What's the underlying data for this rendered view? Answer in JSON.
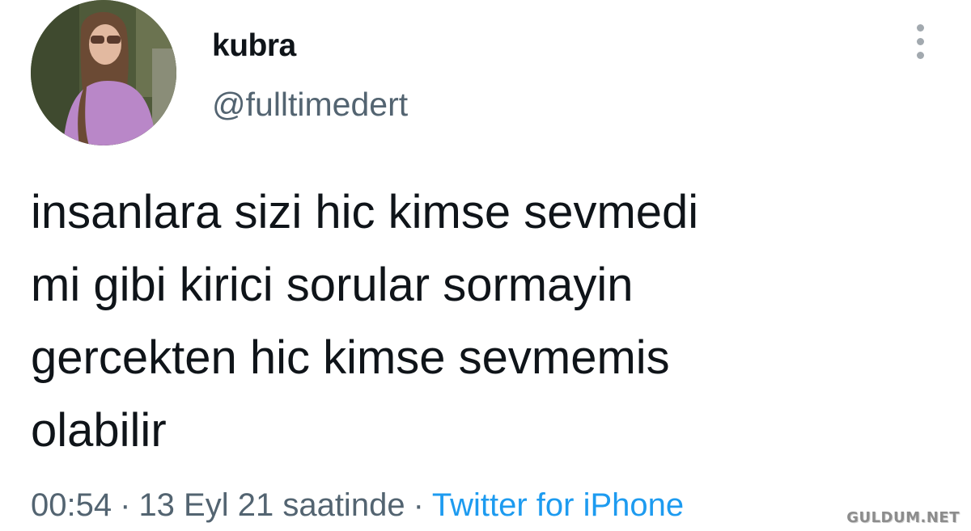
{
  "author": {
    "display_name": "kubra",
    "handle": "@fulltimedert",
    "avatar_icon": "profile-photo"
  },
  "menu": {
    "icon": "more-vertical-icon"
  },
  "tweet": {
    "lines": [
      "insanlara sizi hic kimse sevmedi",
      "mi gibi kirici sorular sormayin",
      "gercekten hic kimse sevmemis",
      "olabilir"
    ]
  },
  "meta": {
    "time": "00:54",
    "date": "13 Eyl 21 saatinde",
    "separator": "·",
    "source": "Twitter for iPhone"
  },
  "watermark": {
    "text": "GULDUM.NET"
  },
  "colors": {
    "text": "#0f1419",
    "secondary": "#536471",
    "link": "#1d9bf0",
    "menu_dots": "#a2a9af"
  }
}
